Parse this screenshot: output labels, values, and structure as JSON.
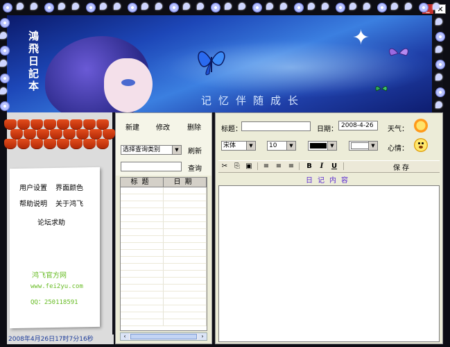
{
  "banner": {
    "vertical_title": "鴻飛日記本",
    "slogan": "记忆伴随成长"
  },
  "window_controls": {
    "minimize": "_",
    "close": "✕"
  },
  "left_panel": {
    "menu": {
      "user_settings": "用户设置",
      "ui_color": "界面颜色",
      "help": "帮助说明",
      "about": "关于鸿飞",
      "forum": "论坛求助"
    },
    "site_title": "鸿飞官方网",
    "site_url": "www.fei2yu.com",
    "site_qq": "QQ：250118591",
    "status_time": "2008年4月26日17时7分16秒"
  },
  "middle_panel": {
    "new": "新建",
    "edit": "修改",
    "delete": "删除",
    "query_type": "选择查询类别",
    "refresh": "刷新",
    "query_value": "",
    "query": "查询",
    "columns": [
      "标题",
      "日期"
    ]
  },
  "right_panel": {
    "title_label": "标题：",
    "title_value": "",
    "date_label": "日期：",
    "date_value": "2008-4-26",
    "weather_label": "天气：",
    "font_name": "宋体",
    "font_size": "10",
    "mood_label": "心情：",
    "save": "保存",
    "content_label": "日记内容",
    "editor_text": ""
  },
  "toolbar_icons": [
    "cut-icon",
    "copy-icon",
    "paste-icon",
    "align-left-icon",
    "align-center-icon",
    "align-right-icon",
    "bold-icon",
    "italic-icon",
    "underline-icon"
  ],
  "colors": {
    "accent_text": "#5a2ad0",
    "status_text": "#1a3a9a",
    "site_green": "#66bb22"
  }
}
